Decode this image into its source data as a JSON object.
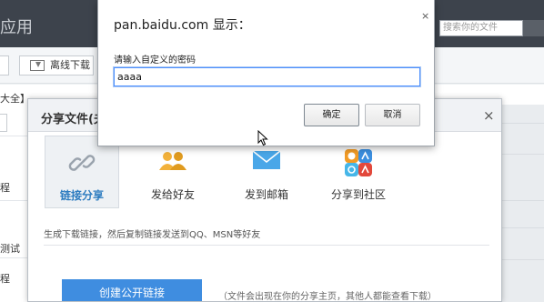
{
  "app": {
    "title": "应用"
  },
  "search": {
    "placeholder": "搜索你的文件"
  },
  "toolbar": {
    "offline_download_label": "离线下载"
  },
  "background_list": {
    "header_fragment": "大全】",
    "rows": [
      "程",
      "测试",
      "程"
    ]
  },
  "share_dialog": {
    "title": "分享文件(夫",
    "close_glyph": "×",
    "options": [
      {
        "label": "链接分享",
        "icon": "link-icon",
        "active": true
      },
      {
        "label": "发给好友",
        "icon": "friends-icon",
        "active": false
      },
      {
        "label": "发到邮箱",
        "icon": "mail-icon",
        "active": false
      },
      {
        "label": "分享到社区",
        "icon": "community-icon",
        "active": false
      }
    ],
    "description": "生成下载链接，然后复制链接发送到QQ、MSN等好友",
    "create_button": "创建公开链接",
    "create_note": "（文件会出现在你的分享主页，其他人都能查看下载）"
  },
  "prompt_dialog": {
    "title": "pan.baidu.com 显示：",
    "close_glyph": "×",
    "message": "请输入自定义的密码",
    "input_value": "aaaa",
    "ok_label": "确定",
    "cancel_label": "取消"
  },
  "colors": {
    "accent": "#3f8de0",
    "topbar": "#3d434c",
    "focus": "#4d90fe"
  }
}
